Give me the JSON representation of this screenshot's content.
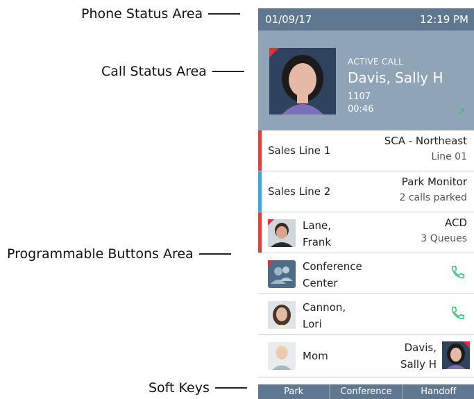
{
  "callouts": {
    "phone_status": "Phone Status Area",
    "call_status": "Call Status Area",
    "programmable": "Programmable Buttons Area",
    "soft_keys": "Soft Keys"
  },
  "status_bar": {
    "date": "01/09/17",
    "time": "12:19 PM"
  },
  "active_call": {
    "label": "ACTIVE CALL",
    "name": "Davis, Sally H",
    "extension": "1107",
    "duration": "00:46"
  },
  "buttons": [
    {
      "label": "Sales Line 1",
      "right_top": "SCA - Northeast",
      "right_bottom": "Line 01",
      "bar_color": "#e0403a"
    },
    {
      "label": "Sales Line 2",
      "right_top": "Park Monitor",
      "right_bottom": "2 calls parked",
      "bar_color": "#3aa8e0"
    },
    {
      "name_line1": "Lane,",
      "name_line2": "Frank",
      "right_top": "ACD",
      "right_bottom": "3 Queues",
      "bar_color": "#e0403a"
    },
    {
      "name_line1": "Conference",
      "name_line2": "Center",
      "icon": "phone-icon"
    },
    {
      "name_line1": "Cannon,",
      "name_line2": "Lori",
      "icon": "phone-icon"
    },
    {
      "name": "Mom",
      "right_line1": "Davis,",
      "right_line2": "Sally H"
    }
  ],
  "softkeys": [
    "Park",
    "Conference",
    "Handoff"
  ],
  "colors": {
    "accent_green": "#2fc070",
    "status_bar": "#5f7890",
    "call_area": "#8fa4b6"
  }
}
